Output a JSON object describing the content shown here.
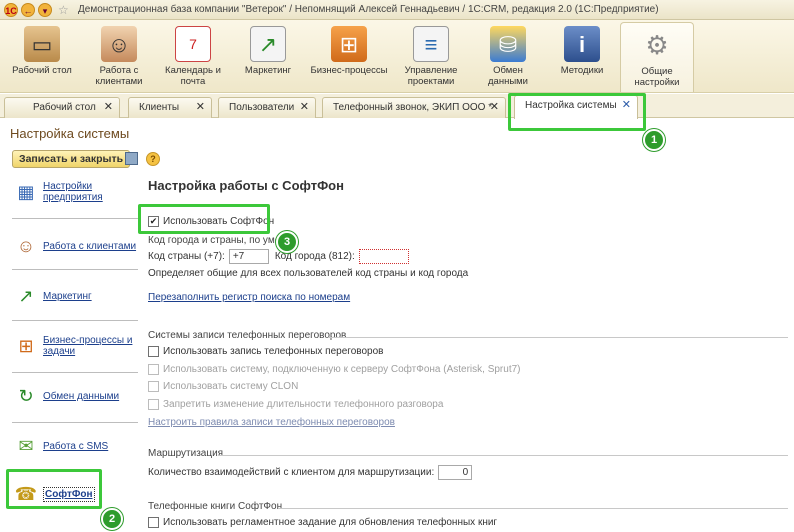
{
  "window": {
    "title": "Демонстрационная база компании \"Ветерок\" / Непомнящий Алексей Геннадьевич / 1С:CRM, редакция 2.0  (1С:Предприятие)",
    "logo_text": "1С"
  },
  "sections": [
    {
      "label": "Рабочий стол",
      "icon": "desk-icon"
    },
    {
      "label": "Работа с клиентами",
      "icon": "people-icon"
    },
    {
      "label": "Календарь и почта",
      "icon": "calendar-icon"
    },
    {
      "label": "Маркетинг",
      "icon": "chart-board-icon"
    },
    {
      "label": "Бизнес-процессы",
      "icon": "process-icon"
    },
    {
      "label": "Управление проектами",
      "icon": "project-icon"
    },
    {
      "label": "Обмен данными",
      "icon": "database-icon"
    },
    {
      "label": "Методики",
      "icon": "info-book-icon"
    },
    {
      "label": "Общие настройки",
      "icon": "gears-icon"
    }
  ],
  "tabs": [
    {
      "label": "Рабочий стол",
      "close": "✕"
    },
    {
      "label": "Клиенты",
      "close": "✕"
    },
    {
      "label": "Пользователи",
      "close": "✕"
    },
    {
      "label": "Телефонный звонок, ЭКИП ООО *",
      "close": "✕"
    },
    {
      "label": "Настройка системы",
      "close": "✕"
    }
  ],
  "page": {
    "title": "Настройка системы",
    "save_close_label": "Записать и закрыть",
    "help_label": "?"
  },
  "nav": [
    {
      "label": "Настройки предприятия"
    },
    {
      "label": "Работа с клиентами"
    },
    {
      "label": "Маркетинг"
    },
    {
      "label": "Бизнес-процессы и задачи"
    },
    {
      "label": "Обмен данными"
    },
    {
      "label": "Работа с SMS"
    },
    {
      "label": "СофтФон"
    }
  ],
  "content": {
    "heading": "Настройка работы с СофтФон",
    "use_softphone": "Использовать СофтФон",
    "code_group": "Код города и страны, по умолч",
    "country_code_label": "Код страны (+7):",
    "country_code_value": "+7",
    "city_code_label": "Код города (812):",
    "city_code_value": "",
    "code_hint": "Определяет общие для всех пользователей код страны и код города",
    "refill_link": "Перезаполнить регистр поиска по номерам",
    "rec_group": "Системы записи телефонных переговоров",
    "rec_use": "Использовать запись телефонных переговоров",
    "rec_server": "Использовать систему, подключенную к серверу СофтФона (Asterisk, Sprut7)",
    "rec_clon": "Использовать систему CLON",
    "rec_forbid": "Запретить изменение длительности телефонного разговора",
    "rec_rules_link": "Настроить правила записи телефонных переговоров",
    "routing_group": "Маршрутизация",
    "routing_label": "Количество взаимодействий с клиентом для маршрутизации:",
    "routing_value": "0",
    "books_group": "Телефонные книги СофтФон",
    "books_use": "Использовать регламентное задание для обновления телефонных книг"
  },
  "callouts": [
    "1",
    "2",
    "3"
  ],
  "colors": {
    "highlight": "#3cc83a",
    "badge": "#2e9c2c",
    "link": "#1c3f8c",
    "title": "#6e4a1f"
  }
}
